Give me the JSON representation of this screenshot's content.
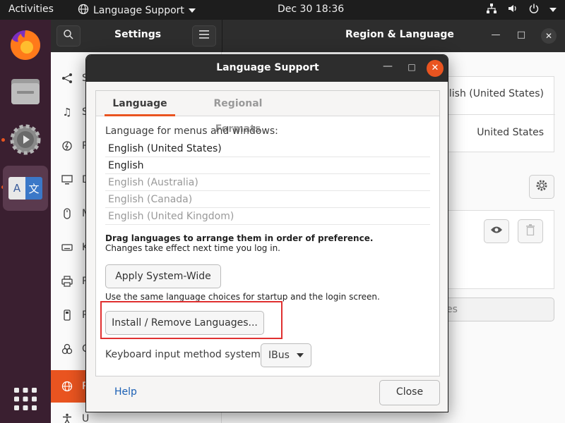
{
  "topbar": {
    "activities": "Activities",
    "app_name": "Language Support",
    "clock": "Dec 30  18:36"
  },
  "dock": {
    "items": [
      "firefox-icon",
      "files-icon",
      "settings-icon",
      "language-support-icon",
      "app-grid-icon"
    ],
    "lang_icon_left": "A",
    "lang_icon_right": "文"
  },
  "settings": {
    "title": "Settings",
    "panel_title": "Region & Language",
    "sidebar": [
      {
        "label": "S",
        "icon": "share-icon"
      },
      {
        "label": "S",
        "icon": "music-icon"
      },
      {
        "label": "P",
        "icon": "power-icon"
      },
      {
        "label": "D",
        "icon": "display-icon"
      },
      {
        "label": "M",
        "icon": "mouse-icon"
      },
      {
        "label": "K",
        "icon": "keyboard-icon"
      },
      {
        "label": "P",
        "icon": "printer-icon"
      },
      {
        "label": "R",
        "icon": "removable-media-icon"
      },
      {
        "label": "C",
        "icon": "color-icon"
      },
      {
        "label": "R",
        "icon": "globe-icon"
      },
      {
        "label": "U",
        "icon": "accessibility-icon"
      }
    ],
    "language_value": "nglish (United States)",
    "formats_value": "United States",
    "input_sources_partial": "es"
  },
  "dialog": {
    "title": "Language Support",
    "tabs": [
      "Language",
      "Regional Formats"
    ],
    "lang_label": "Language for menus and windows:",
    "languages": [
      {
        "name": "English (United States)",
        "style": "primary"
      },
      {
        "name": "English",
        "style": "primary"
      },
      {
        "name": "English (Australia)",
        "style": "secondary"
      },
      {
        "name": "English (Canada)",
        "style": "secondary"
      },
      {
        "name": "English (United Kingdom)",
        "style": "secondary"
      }
    ],
    "drag_note_bold": "Drag languages to arrange them in order of preference.",
    "drag_note": "Changes take effect next time you log in.",
    "apply_button": "Apply System-Wide",
    "use_note": "Use the same language choices for startup and the login screen.",
    "install_button": "Install / Remove Languages...",
    "kbd_label": "Keyboard input method system:",
    "kbd_value": "IBus",
    "help": "Help",
    "close": "Close"
  },
  "colors": {
    "accent": "#e95420",
    "highlight": "#e03030",
    "link": "#1a5fb4"
  }
}
